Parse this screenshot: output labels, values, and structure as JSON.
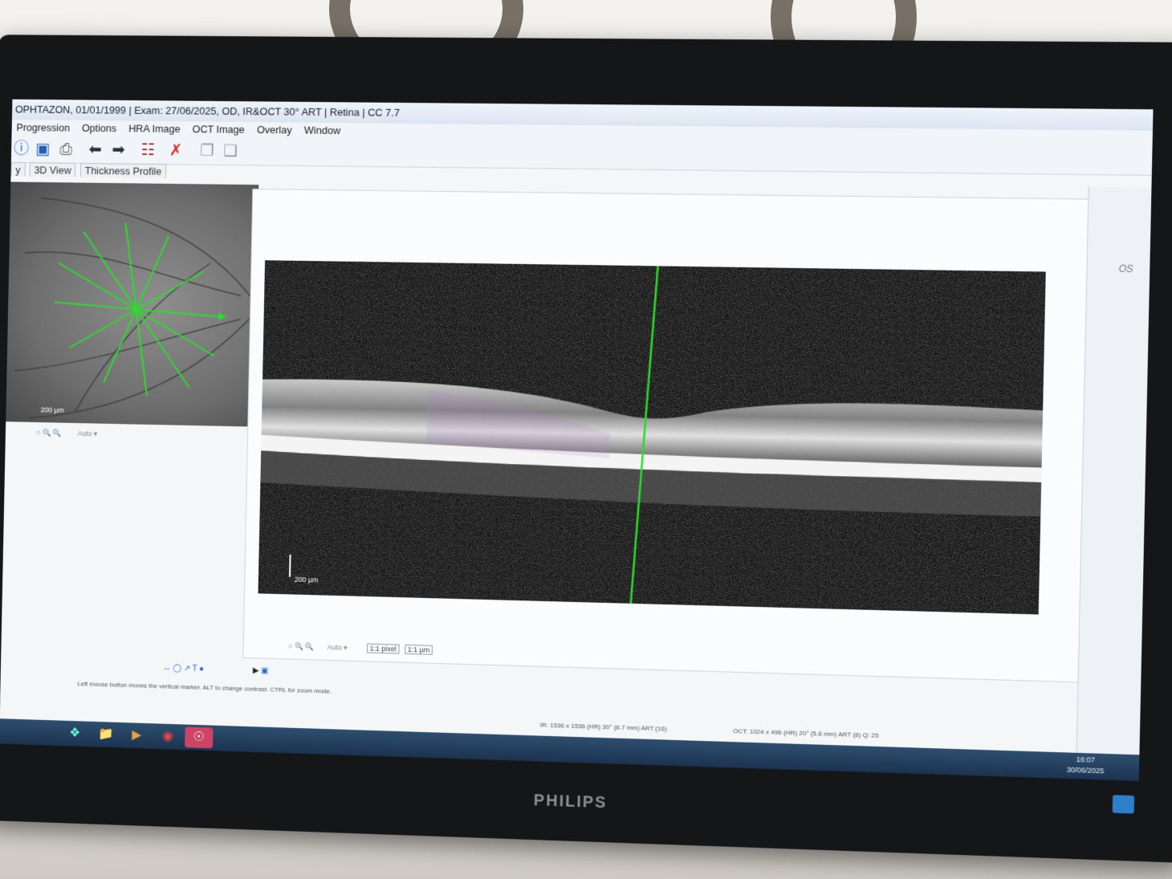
{
  "window": {
    "title": "OPHTAZON, 01/01/1999  |  Exam: 27/06/2025, OD, IR&OCT 30° ART  |  Retina  |  CC 7.7"
  },
  "menu": [
    "Progression",
    "Options",
    "HRA Image",
    "OCT Image",
    "Overlay",
    "Window"
  ],
  "toolbar": {
    "icons": [
      "info-icon",
      "save-icon",
      "print-icon",
      "back-arrow-icon",
      "forward-arrow-icon",
      "report-icon",
      "delete-icon",
      "copy-icon",
      "paste-icon"
    ]
  },
  "tabs": [
    "y",
    "3D View",
    "Thickness Profile"
  ],
  "fundus": {
    "scale_label": "200 µm",
    "zoom_select": "Auto"
  },
  "oct": {
    "scale_label": "200 µm",
    "zoom_select": "Auto",
    "pixel_btn": "1:1 pixel",
    "um_btn": "1:1 µm",
    "side_eye_label": "OS"
  },
  "status": {
    "hint": "Left mouse button moves the vertical marker. ALT to change contrast. CTRL for zoom mode.",
    "ir_info": "IR: 1536 x 1536 (HR) 30° (8.7 mm) ART (16)",
    "oct_info": "OCT: 1024 x 496 (HR) 20° (5.8 mm) ART (8) Q: 25"
  },
  "taskbar": {
    "time": "16:07",
    "date": "30/06/2025"
  },
  "monitor": {
    "brand": "PHILIPS"
  },
  "colors": {
    "scan_line": "#2bdc2b",
    "close_button": "#d0402c",
    "taskbar": "#1a3350"
  }
}
